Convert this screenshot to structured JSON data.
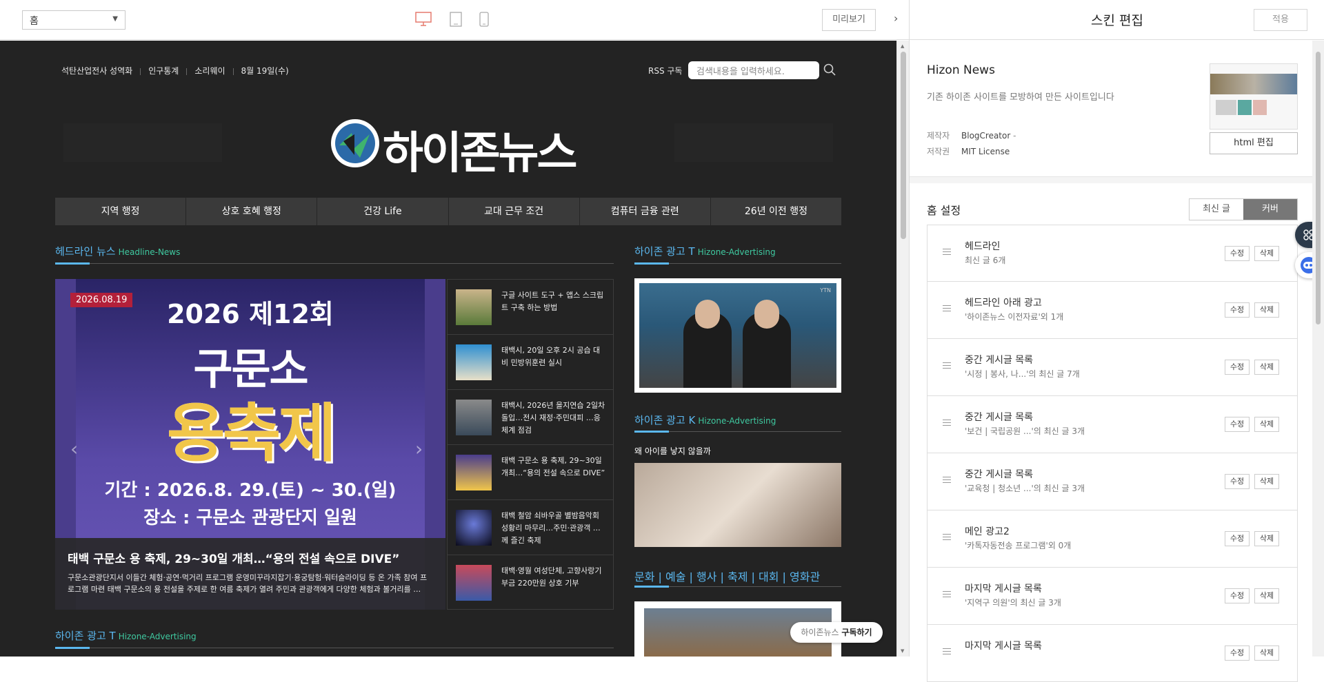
{
  "topbar": {
    "page_select_value": "홈",
    "preview_label": "미리보기",
    "panel_title": "스킨 편집",
    "apply_label": "적용"
  },
  "site": {
    "top_links": [
      "석탄산업전사 성역화",
      "인구통계",
      "소리웨이",
      "8월 19일(수)"
    ],
    "rss_label": "RSS 구독",
    "search_placeholder": "검색내용을 입력하세요.",
    "logo_text": "하이존뉴스",
    "nav": [
      "지역 행정",
      "상호 호혜 행정",
      "건강 Life",
      "교대 근무 조건",
      "컴퓨터 금융 관련",
      "26년 이전 행정"
    ],
    "headline_title": "헤드라인 뉴스",
    "headline_sub": "Headline-News",
    "banner": {
      "date": "2026.08.19",
      "line1": "2026 제12회",
      "line2": "구문소",
      "line3": "용축제",
      "period": "기간 : 2026.8. 29.(토) ~ 30.(일)",
      "place": "장소 : 구문소 관광단지 일원",
      "caption_title": "태백 구문소 용 축제, 29~30일 개최…“용의 전설 속으로 DIVE”",
      "caption_desc": "구문소관광단지서 이들간 체험·공연·먹거리 프로그램 운영미꾸라지잡기·용궁탐험·워터슬라이딩 등 온 가족 참여 프로그램 마련 태백 구문소의 용 전설을 주제로 한 여름 축제가 열려 주민과 관광객에게 다양한 체험과 볼거리를 …"
    },
    "side_news": [
      "구글 사이트 도구 + 앱스 스크립트 구축 하는 방법",
      "태백시, 20일 오후 2시 공습 대비 민방위훈련 실시",
      "태백시, 2026년 을지연습 2일차 돌입…전시 재정·주민대피 …응체계 점검",
      "태백 구문소 용 축제, 29~30일 개최…“용의 전설 속으로 DIVE”",
      "태백 철암 쇠바우골 별밤음악회 성황리 마무리…주민·관광객 …께 즐긴 축제",
      "태백·영월 여성단체, 고향사랑기부금 220만원 상호 기부"
    ],
    "ad_t_title": "하이존 광고 T",
    "ad_t_sub": "Hizone-Advertising",
    "ad_k_title": "하이존 광고 K",
    "ad_k_sub": "Hizone-Advertising",
    "ad_t2_title": "하이존 광고 T",
    "ad_t2_sub": "Hizone-Advertising",
    "tv_logo": "YTN",
    "why_text": "왜 아이를 낳지 않을까",
    "culture_title": "문화 | 예술 | 행사 | 축제 | 대회 | 영화관",
    "subscribe_prefix": "하이존뉴스",
    "subscribe_action": "구독하기"
  },
  "panel": {
    "skin_name": "Hizon News",
    "skin_desc": "기존 하이존 사이트를 모방하여 만든 사이트입니다",
    "maker_key": "제작자",
    "maker_val": "BlogCreator",
    "maker_dash": "-",
    "license_key": "저작권",
    "license_val": "MIT License",
    "html_edit": "html 편집",
    "home_settings": "홈 설정",
    "toggle_latest": "최신 글",
    "toggle_cover": "커버",
    "edit_label": "수정",
    "delete_label": "삭제",
    "blocks": [
      {
        "name": "헤드라인",
        "sub": "최신 글 6개"
      },
      {
        "name": "헤드라인 아래 광고",
        "sub": "'하이존뉴스 이전자료'외 1개"
      },
      {
        "name": "중간 게시글 목록",
        "sub": "'시정 | 봉사, 나...'의 최신 글 7개"
      },
      {
        "name": "중간 게시글 목록",
        "sub": "'보건 | 국립공원 ...'의 최신 글 3개"
      },
      {
        "name": "중간 게시글 목록",
        "sub": "'교육청 | 청소년 ...'의 최신 글 3개"
      },
      {
        "name": "메인 광고2",
        "sub": "'카톡자동전송 프로그램'외 0개"
      },
      {
        "name": "마지막 게시글 목록",
        "sub": "'지역구 의원'의 최신 글 3개"
      },
      {
        "name": "마지막 게시글 목록",
        "sub": ""
      }
    ]
  },
  "colors": {
    "accent_blue": "#5bb8f0",
    "accent_green": "#3fc9a0",
    "badge_red": "#b3203a",
    "preview_bg": "#232323"
  }
}
